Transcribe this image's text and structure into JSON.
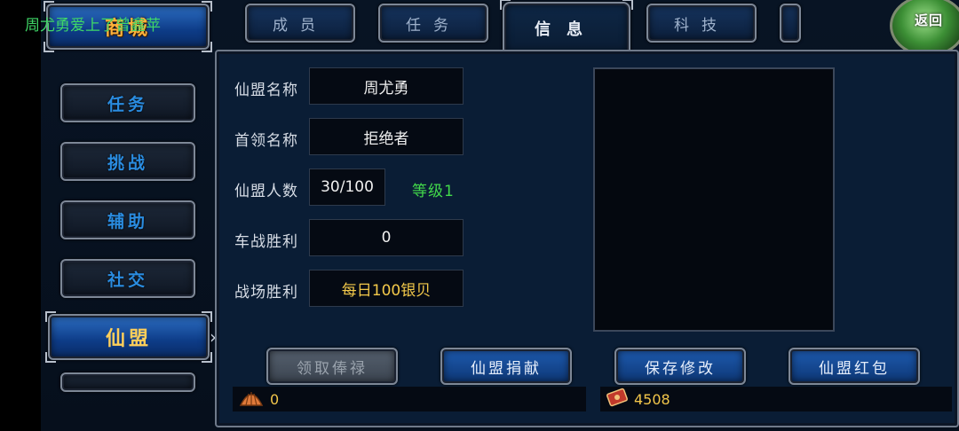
{
  "shop": {
    "label": "商城"
  },
  "tabs": [
    {
      "label": "成员"
    },
    {
      "label": "任务"
    },
    {
      "label": "信息"
    },
    {
      "label": "科技"
    }
  ],
  "back": {
    "label": "返回"
  },
  "sidebar": {
    "items": [
      {
        "label": "任务"
      },
      {
        "label": "挑战"
      },
      {
        "label": "辅助"
      },
      {
        "label": "社交"
      },
      {
        "label": "仙盟"
      }
    ]
  },
  "info": {
    "rows": [
      {
        "label": "仙盟名称",
        "value": "周尤勇"
      },
      {
        "label": "首领名称",
        "value": "拒绝者"
      },
      {
        "label": "仙盟人数",
        "value": "30/100",
        "extra": "等级1"
      },
      {
        "label": "车战胜利",
        "value": "0"
      },
      {
        "label": "战场胜利",
        "value": "每日100银贝"
      }
    ]
  },
  "notice": {
    "text": "周尤勇爱上了曾鑫苹"
  },
  "actions": [
    {
      "label": "领取俸禄"
    },
    {
      "label": "仙盟捐献"
    },
    {
      "label": "保存修改"
    },
    {
      "label": "仙盟红包"
    }
  ],
  "resources": [
    {
      "icon": "shell-icon",
      "value": "0"
    },
    {
      "icon": "ticket-icon",
      "value": "4508"
    }
  ],
  "colors": {
    "accent_blue": "#1e5bb0",
    "gold": "#f3c94a",
    "green": "#42d94a"
  }
}
